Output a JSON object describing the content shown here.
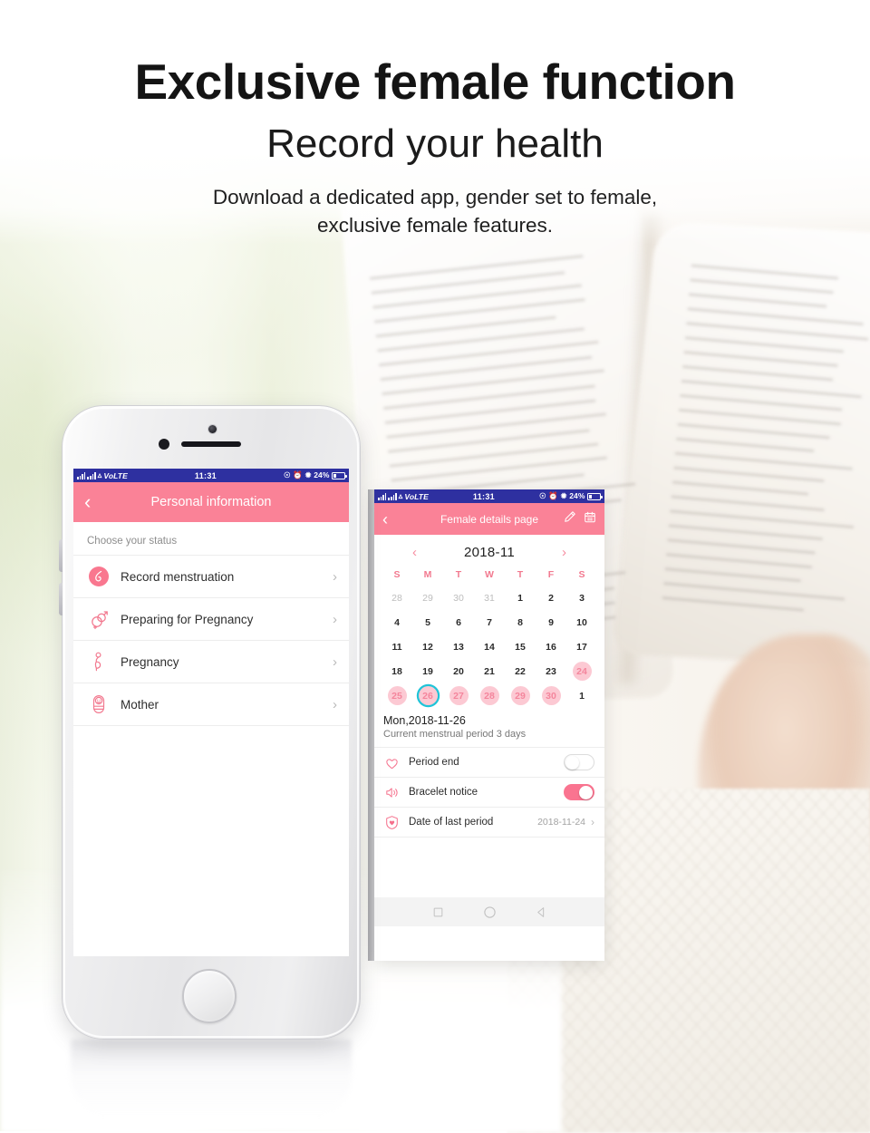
{
  "headline": {
    "line1": "Exclusive female function",
    "line2": "Record your health",
    "line3a": "Download a dedicated app, gender set to female,",
    "line3b": "exclusive female features."
  },
  "colors": {
    "header_pink": "#FA8297",
    "accent_pink": "#F2798F",
    "period_chip": "#FCC9D3",
    "today_ring": "#1FC4D8",
    "toggle_on": "#FA7490",
    "statusbar_blue": "#2E30A0"
  },
  "left_phone": {
    "status_bar": {
      "carrier": "VoLTE",
      "time": "11:31",
      "battery_percent": "24%",
      "icons": [
        "signal-bars",
        "signal-bars",
        "wifi-icon",
        "mute-icon",
        "alarm-icon",
        "bluetooth-icon",
        "battery-icon"
      ]
    },
    "header": {
      "back_icon": "chevron-left-icon",
      "title": "Personal information"
    },
    "section_label": "Choose your status",
    "status_items": [
      {
        "icon": "menstruation-icon",
        "label": "Record menstruation",
        "chevron": "chevron-right-icon",
        "selected": true
      },
      {
        "icon": "preparing-pregnancy-icon",
        "label": "Preparing for Pregnancy",
        "chevron": "chevron-right-icon",
        "selected": false
      },
      {
        "icon": "pregnancy-icon",
        "label": "Pregnancy",
        "chevron": "chevron-right-icon",
        "selected": false
      },
      {
        "icon": "mother-baby-icon",
        "label": "Mother",
        "chevron": "chevron-right-icon",
        "selected": false
      }
    ]
  },
  "right_phone": {
    "status_bar": {
      "carrier": "VoLTE",
      "time": "11:31",
      "battery_percent": "24%"
    },
    "header": {
      "back_icon": "chevron-left-icon",
      "title": "Female details page",
      "actions": [
        "edit-pen-icon",
        "calendar-icon"
      ]
    },
    "calendar": {
      "prev_icon": "chevron-left-icon",
      "month_label": "2018-11",
      "next_icon": "chevron-right-icon",
      "day_of_week": [
        "S",
        "M",
        "T",
        "W",
        "T",
        "F",
        "S"
      ],
      "weeks": [
        [
          {
            "d": "28",
            "state": "muted"
          },
          {
            "d": "29",
            "state": "muted"
          },
          {
            "d": "30",
            "state": "muted"
          },
          {
            "d": "31",
            "state": "muted"
          },
          {
            "d": "1",
            "state": "normal"
          },
          {
            "d": "2",
            "state": "normal"
          },
          {
            "d": "3",
            "state": "normal"
          }
        ],
        [
          {
            "d": "4",
            "state": "normal"
          },
          {
            "d": "5",
            "state": "normal"
          },
          {
            "d": "6",
            "state": "normal"
          },
          {
            "d": "7",
            "state": "normal"
          },
          {
            "d": "8",
            "state": "normal"
          },
          {
            "d": "9",
            "state": "normal"
          },
          {
            "d": "10",
            "state": "normal"
          }
        ],
        [
          {
            "d": "11",
            "state": "normal"
          },
          {
            "d": "12",
            "state": "normal"
          },
          {
            "d": "13",
            "state": "normal"
          },
          {
            "d": "14",
            "state": "normal"
          },
          {
            "d": "15",
            "state": "normal"
          },
          {
            "d": "16",
            "state": "normal"
          },
          {
            "d": "17",
            "state": "normal"
          }
        ],
        [
          {
            "d": "18",
            "state": "normal"
          },
          {
            "d": "19",
            "state": "normal"
          },
          {
            "d": "20",
            "state": "normal"
          },
          {
            "d": "21",
            "state": "normal"
          },
          {
            "d": "22",
            "state": "normal"
          },
          {
            "d": "23",
            "state": "normal"
          },
          {
            "d": "24",
            "state": "period"
          }
        ],
        [
          {
            "d": "25",
            "state": "period"
          },
          {
            "d": "26",
            "state": "period today"
          },
          {
            "d": "27",
            "state": "period"
          },
          {
            "d": "28",
            "state": "period"
          },
          {
            "d": "29",
            "state": "period"
          },
          {
            "d": "30",
            "state": "period"
          },
          {
            "d": "1",
            "state": "normal"
          }
        ]
      ]
    },
    "selected_date": "Mon,2018-11-26",
    "period_summary": "Current menstrual period 3 days",
    "preferences": [
      {
        "icon": "double-heart-icon",
        "label": "Period end",
        "control": "toggle",
        "state": "off"
      },
      {
        "icon": "speaker-icon",
        "label": "Bracelet notice",
        "control": "toggle",
        "state": "on"
      },
      {
        "icon": "heart-shield-icon",
        "label": "Date of last period",
        "control": "value",
        "value": "2018-11-24",
        "chevron": "chevron-right-icon"
      }
    ],
    "nav_bar": [
      "square-recents-icon",
      "circle-home-icon",
      "triangle-back-icon"
    ]
  }
}
